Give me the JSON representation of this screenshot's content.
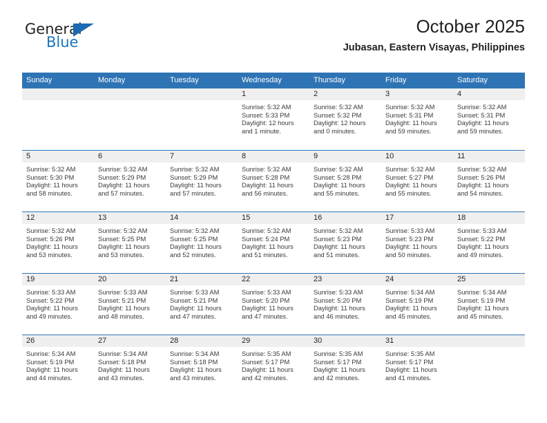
{
  "brand": {
    "name_part1": "General",
    "name_part2": "Blue",
    "accent_color": "#1b75bc"
  },
  "header": {
    "title": "October 2025",
    "location": "Jubasan, Eastern Visayas, Philippines"
  },
  "theme": {
    "header_bg": "#2e74b5",
    "daynum_bg": "#efefef",
    "rule_color": "#2e74b5"
  },
  "weekdays": [
    "Sunday",
    "Monday",
    "Tuesday",
    "Wednesday",
    "Thursday",
    "Friday",
    "Saturday"
  ],
  "weeks": [
    [
      {
        "day": "",
        "sunrise": "",
        "sunset": "",
        "daylight1": "",
        "daylight2": ""
      },
      {
        "day": "",
        "sunrise": "",
        "sunset": "",
        "daylight1": "",
        "daylight2": ""
      },
      {
        "day": "",
        "sunrise": "",
        "sunset": "",
        "daylight1": "",
        "daylight2": ""
      },
      {
        "day": "1",
        "sunrise": "Sunrise: 5:32 AM",
        "sunset": "Sunset: 5:33 PM",
        "daylight1": "Daylight: 12 hours",
        "daylight2": "and 1 minute."
      },
      {
        "day": "2",
        "sunrise": "Sunrise: 5:32 AM",
        "sunset": "Sunset: 5:32 PM",
        "daylight1": "Daylight: 12 hours",
        "daylight2": "and 0 minutes."
      },
      {
        "day": "3",
        "sunrise": "Sunrise: 5:32 AM",
        "sunset": "Sunset: 5:31 PM",
        "daylight1": "Daylight: 11 hours",
        "daylight2": "and 59 minutes."
      },
      {
        "day": "4",
        "sunrise": "Sunrise: 5:32 AM",
        "sunset": "Sunset: 5:31 PM",
        "daylight1": "Daylight: 11 hours",
        "daylight2": "and 59 minutes."
      }
    ],
    [
      {
        "day": "5",
        "sunrise": "Sunrise: 5:32 AM",
        "sunset": "Sunset: 5:30 PM",
        "daylight1": "Daylight: 11 hours",
        "daylight2": "and 58 minutes."
      },
      {
        "day": "6",
        "sunrise": "Sunrise: 5:32 AM",
        "sunset": "Sunset: 5:29 PM",
        "daylight1": "Daylight: 11 hours",
        "daylight2": "and 57 minutes."
      },
      {
        "day": "7",
        "sunrise": "Sunrise: 5:32 AM",
        "sunset": "Sunset: 5:29 PM",
        "daylight1": "Daylight: 11 hours",
        "daylight2": "and 57 minutes."
      },
      {
        "day": "8",
        "sunrise": "Sunrise: 5:32 AM",
        "sunset": "Sunset: 5:28 PM",
        "daylight1": "Daylight: 11 hours",
        "daylight2": "and 56 minutes."
      },
      {
        "day": "9",
        "sunrise": "Sunrise: 5:32 AM",
        "sunset": "Sunset: 5:28 PM",
        "daylight1": "Daylight: 11 hours",
        "daylight2": "and 55 minutes."
      },
      {
        "day": "10",
        "sunrise": "Sunrise: 5:32 AM",
        "sunset": "Sunset: 5:27 PM",
        "daylight1": "Daylight: 11 hours",
        "daylight2": "and 55 minutes."
      },
      {
        "day": "11",
        "sunrise": "Sunrise: 5:32 AM",
        "sunset": "Sunset: 5:26 PM",
        "daylight1": "Daylight: 11 hours",
        "daylight2": "and 54 minutes."
      }
    ],
    [
      {
        "day": "12",
        "sunrise": "Sunrise: 5:32 AM",
        "sunset": "Sunset: 5:26 PM",
        "daylight1": "Daylight: 11 hours",
        "daylight2": "and 53 minutes."
      },
      {
        "day": "13",
        "sunrise": "Sunrise: 5:32 AM",
        "sunset": "Sunset: 5:25 PM",
        "daylight1": "Daylight: 11 hours",
        "daylight2": "and 53 minutes."
      },
      {
        "day": "14",
        "sunrise": "Sunrise: 5:32 AM",
        "sunset": "Sunset: 5:25 PM",
        "daylight1": "Daylight: 11 hours",
        "daylight2": "and 52 minutes."
      },
      {
        "day": "15",
        "sunrise": "Sunrise: 5:32 AM",
        "sunset": "Sunset: 5:24 PM",
        "daylight1": "Daylight: 11 hours",
        "daylight2": "and 51 minutes."
      },
      {
        "day": "16",
        "sunrise": "Sunrise: 5:32 AM",
        "sunset": "Sunset: 5:23 PM",
        "daylight1": "Daylight: 11 hours",
        "daylight2": "and 51 minutes."
      },
      {
        "day": "17",
        "sunrise": "Sunrise: 5:33 AM",
        "sunset": "Sunset: 5:23 PM",
        "daylight1": "Daylight: 11 hours",
        "daylight2": "and 50 minutes."
      },
      {
        "day": "18",
        "sunrise": "Sunrise: 5:33 AM",
        "sunset": "Sunset: 5:22 PM",
        "daylight1": "Daylight: 11 hours",
        "daylight2": "and 49 minutes."
      }
    ],
    [
      {
        "day": "19",
        "sunrise": "Sunrise: 5:33 AM",
        "sunset": "Sunset: 5:22 PM",
        "daylight1": "Daylight: 11 hours",
        "daylight2": "and 49 minutes."
      },
      {
        "day": "20",
        "sunrise": "Sunrise: 5:33 AM",
        "sunset": "Sunset: 5:21 PM",
        "daylight1": "Daylight: 11 hours",
        "daylight2": "and 48 minutes."
      },
      {
        "day": "21",
        "sunrise": "Sunrise: 5:33 AM",
        "sunset": "Sunset: 5:21 PM",
        "daylight1": "Daylight: 11 hours",
        "daylight2": "and 47 minutes."
      },
      {
        "day": "22",
        "sunrise": "Sunrise: 5:33 AM",
        "sunset": "Sunset: 5:20 PM",
        "daylight1": "Daylight: 11 hours",
        "daylight2": "and 47 minutes."
      },
      {
        "day": "23",
        "sunrise": "Sunrise: 5:33 AM",
        "sunset": "Sunset: 5:20 PM",
        "daylight1": "Daylight: 11 hours",
        "daylight2": "and 46 minutes."
      },
      {
        "day": "24",
        "sunrise": "Sunrise: 5:34 AM",
        "sunset": "Sunset: 5:19 PM",
        "daylight1": "Daylight: 11 hours",
        "daylight2": "and 45 minutes."
      },
      {
        "day": "25",
        "sunrise": "Sunrise: 5:34 AM",
        "sunset": "Sunset: 5:19 PM",
        "daylight1": "Daylight: 11 hours",
        "daylight2": "and 45 minutes."
      }
    ],
    [
      {
        "day": "26",
        "sunrise": "Sunrise: 5:34 AM",
        "sunset": "Sunset: 5:19 PM",
        "daylight1": "Daylight: 11 hours",
        "daylight2": "and 44 minutes."
      },
      {
        "day": "27",
        "sunrise": "Sunrise: 5:34 AM",
        "sunset": "Sunset: 5:18 PM",
        "daylight1": "Daylight: 11 hours",
        "daylight2": "and 43 minutes."
      },
      {
        "day": "28",
        "sunrise": "Sunrise: 5:34 AM",
        "sunset": "Sunset: 5:18 PM",
        "daylight1": "Daylight: 11 hours",
        "daylight2": "and 43 minutes."
      },
      {
        "day": "29",
        "sunrise": "Sunrise: 5:35 AM",
        "sunset": "Sunset: 5:17 PM",
        "daylight1": "Daylight: 11 hours",
        "daylight2": "and 42 minutes."
      },
      {
        "day": "30",
        "sunrise": "Sunrise: 5:35 AM",
        "sunset": "Sunset: 5:17 PM",
        "daylight1": "Daylight: 11 hours",
        "daylight2": "and 42 minutes."
      },
      {
        "day": "31",
        "sunrise": "Sunrise: 5:35 AM",
        "sunset": "Sunset: 5:17 PM",
        "daylight1": "Daylight: 11 hours",
        "daylight2": "and 41 minutes."
      },
      {
        "day": "",
        "sunrise": "",
        "sunset": "",
        "daylight1": "",
        "daylight2": ""
      }
    ]
  ]
}
